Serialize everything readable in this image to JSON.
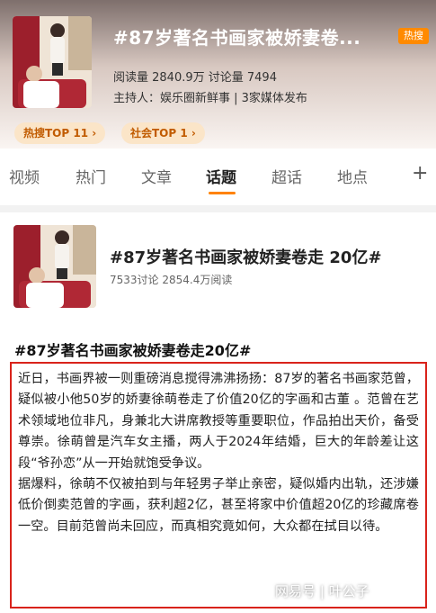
{
  "topic": {
    "title": "#87岁著名书画家被娇妻卷...",
    "hot_badge": "热搜",
    "stats": "阅读量 2840.9万  讨论量 7494",
    "host": "主持人：娱乐圈新鲜事 | 3家媒体发布",
    "rank_tags": [
      "热搜TOP 11 ›",
      "社会TOP 1 ›"
    ]
  },
  "tabs": {
    "items": [
      "视频",
      "热门",
      "文章",
      "话题",
      "超话",
      "地点"
    ],
    "active": "话题",
    "plus": "+"
  },
  "card": {
    "title": "#87岁著名书画家被娇妻卷走 20亿#",
    "stats": "7533讨论  2854.4万阅读"
  },
  "article": {
    "title": "#87岁著名书画家被娇妻卷走20亿#",
    "paragraphs": [
      "近日，书画界被一则重磅消息搅得沸沸扬扬：87岁的著名书画家范曾，疑似被小他50岁的娇妻徐萌卷走了价值20亿的字画和古董 。范曾在艺术领域地位非凡，身兼北大讲席教授等重要职位，作品拍出天价，备受尊崇。徐萌曾是汽车女主播，两人于2024年结婚，巨大的年龄差让这段“爷孙恋”从一开始就饱受争议。",
      "据爆料，徐萌不仅被拍到与年轻男子举止亲密，疑似婚内出轨，还涉嫌低价倒卖范曾的字画，获利超2亿，甚至将家中价值超20亿的珍藏席卷一空。目前范曾尚未回应，而真相究竟如何，大众都在拭目以待。"
    ]
  },
  "watermark": "网易号 | 叶公子",
  "colors": {
    "accent": "#ff8200",
    "highlight_border": "#d9231b",
    "tag_bg": "#fbe5c8",
    "tag_text": "#c15b00"
  }
}
